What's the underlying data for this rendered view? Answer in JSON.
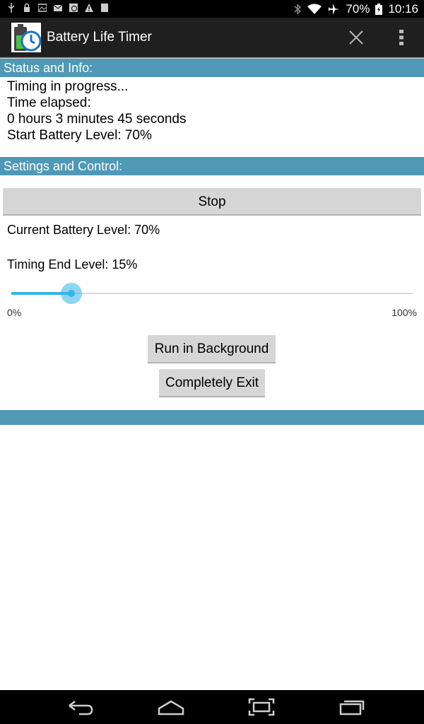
{
  "status_bar": {
    "battery_pct": "70%",
    "time": "10:16"
  },
  "action_bar": {
    "title": "Battery Life Timer"
  },
  "status_section": {
    "header": "Status and Info:",
    "lines": [
      "Timing in progress...",
      "Time elapsed:",
      "0 hours 3 minutes 45 seconds",
      "Start Battery Level: 70%"
    ]
  },
  "settings_section": {
    "header": "Settings and Control:",
    "stop_label": "Stop",
    "current_level": "Current Battery Level: 70%",
    "end_level_label": "Timing End Level: 15%",
    "slider": {
      "value": 15,
      "min_label": "0%",
      "max_label": "100%"
    },
    "run_background_label": "Run in Background",
    "exit_label": "Completely Exit"
  },
  "colors": {
    "section_header": "#4f98b6",
    "accent": "#33b5e5",
    "button": "#d6d6d6"
  }
}
